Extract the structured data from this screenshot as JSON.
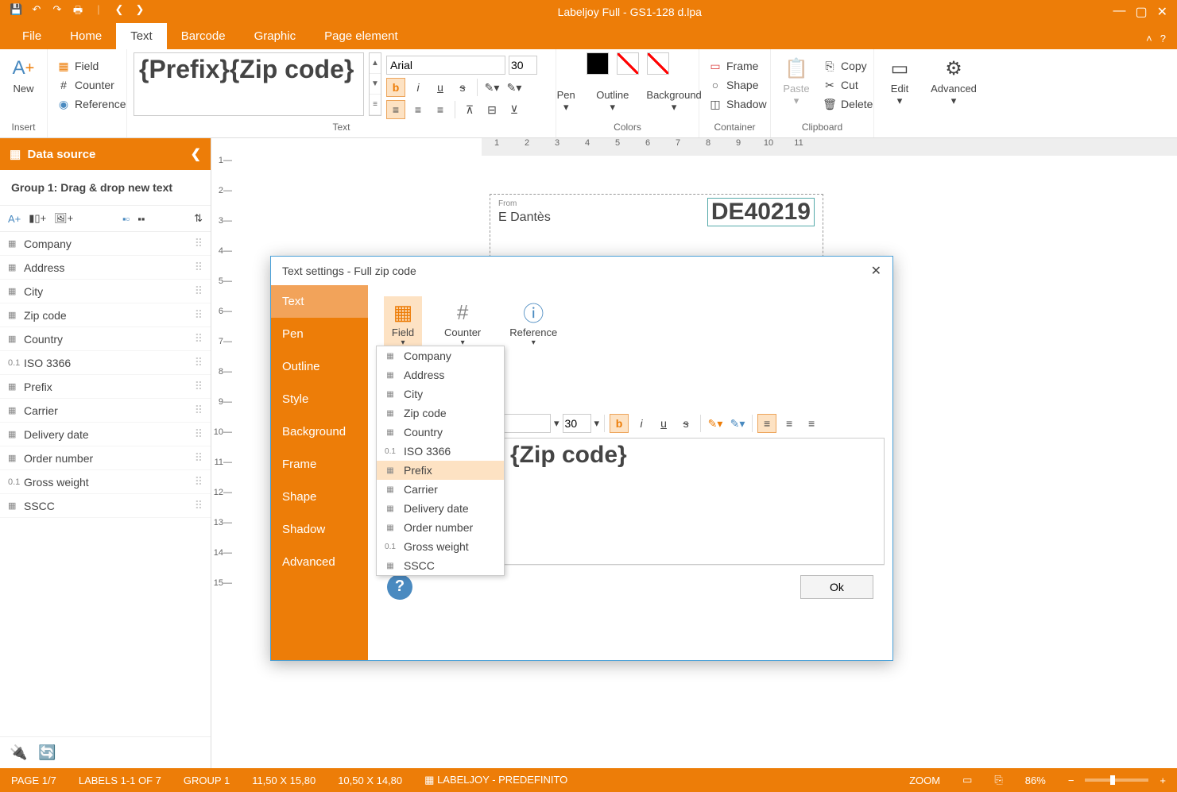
{
  "title": "Labeljoy Full - GS1-128 d.lpa",
  "menu": {
    "file": "File",
    "home": "Home",
    "text": "Text",
    "barcode": "Barcode",
    "graphic": "Graphic",
    "page_element": "Page element"
  },
  "ribbon": {
    "insert_group": "Insert",
    "new": "New",
    "field": "Field",
    "counter": "Counter",
    "reference": "Reference",
    "text_group": "Text",
    "preview": "{Prefix}{Zip code}",
    "font": "Arial",
    "size": "30",
    "colors_group": "Colors",
    "pen": "Pen",
    "outline": "Outline",
    "background": "Background",
    "container_group": "Container",
    "frame": "Frame",
    "shape": "Shape",
    "shadow": "Shadow",
    "clipboard_group": "Clipboard",
    "paste": "Paste",
    "copy": "Copy",
    "cut": "Cut",
    "delete": "Delete",
    "edit": "Edit",
    "advanced": "Advanced"
  },
  "datasource": {
    "title": "Data source",
    "group": "Group 1: Drag & drop new text",
    "items": [
      {
        "icon": "▦",
        "label": "Company"
      },
      {
        "icon": "▦",
        "label": "Address"
      },
      {
        "icon": "▦",
        "label": "City"
      },
      {
        "icon": "▦",
        "label": "Zip code"
      },
      {
        "icon": "▦",
        "label": "Country"
      },
      {
        "icon": "0.1",
        "label": "ISO 3366"
      },
      {
        "icon": "▦",
        "label": "Prefix"
      },
      {
        "icon": "▦",
        "label": "Carrier"
      },
      {
        "icon": "▦",
        "label": "Delivery date"
      },
      {
        "icon": "▦",
        "label": "Order number"
      },
      {
        "icon": "0.1",
        "label": "Gross weight"
      },
      {
        "icon": "▦",
        "label": "SSCC"
      }
    ]
  },
  "canvas": {
    "from_label": "From",
    "from_name": "E Dantès",
    "zip_display": "DE40219"
  },
  "modal": {
    "title": "Text settings - Full zip code",
    "nav": [
      "Text",
      "Pen",
      "Outline",
      "Style",
      "Background",
      "Frame",
      "Shape",
      "Shadow",
      "Advanced"
    ],
    "fieldbtns": {
      "field": "Field",
      "counter": "Counter",
      "reference": "Reference"
    },
    "dropdown": [
      {
        "icon": "▦",
        "label": "Company"
      },
      {
        "icon": "▦",
        "label": "Address"
      },
      {
        "icon": "▦",
        "label": "City"
      },
      {
        "icon": "▦",
        "label": "Zip code"
      },
      {
        "icon": "▦",
        "label": "Country"
      },
      {
        "icon": "0.1",
        "label": "ISO 3366"
      },
      {
        "icon": "▦",
        "label": "Prefix"
      },
      {
        "icon": "▦",
        "label": "Carrier"
      },
      {
        "icon": "▦",
        "label": "Delivery date"
      },
      {
        "icon": "▦",
        "label": "Order number"
      },
      {
        "icon": "0.1",
        "label": "Gross weight"
      },
      {
        "icon": "▦",
        "label": "SSCC"
      }
    ],
    "font": "Arial",
    "size": "30",
    "editor_text": "{Zip code}",
    "ok": "Ok"
  },
  "statusbar": {
    "page": "PAGE 1/7",
    "labels": "LABELS 1-1 OF 7",
    "group": "GROUP 1",
    "dim1": "11,50 X 15,80",
    "dim2": "10,50 X 14,80",
    "name": "LABELJOY - PREDEFINITO",
    "zoom_label": "ZOOM",
    "zoom": "86%"
  }
}
